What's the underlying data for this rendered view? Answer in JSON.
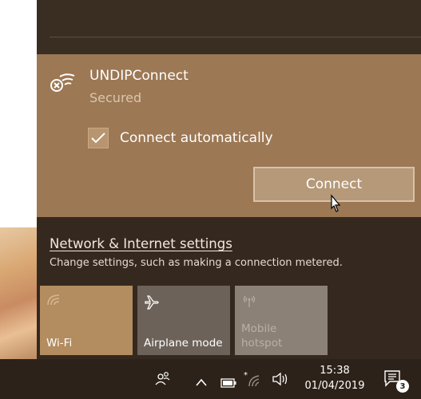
{
  "network": {
    "name": "UNDIPConnect",
    "status": "Secured",
    "connect_automatically_label": "Connect automatically",
    "connect_automatically_checked": true,
    "connect_button_label": "Connect"
  },
  "settings": {
    "link_label": "Network & Internet settings",
    "description": "Change settings, such as making a connection metered."
  },
  "quick_actions": [
    {
      "label": "Wi-Fi",
      "icon": "wifi-icon",
      "active": true
    },
    {
      "label": "Airplane mode",
      "icon": "airplane-icon",
      "active": false
    },
    {
      "label": "Mobile hotspot",
      "icon": "hotspot-icon",
      "active": false,
      "disabled": true
    }
  ],
  "taskbar": {
    "time": "15:38",
    "date": "01/04/2019",
    "notification_count": "3"
  },
  "colors": {
    "flyout_bg": "#35291f",
    "selected_network_bg": "#9c7854",
    "wifi_tile_active": "#b38c5f",
    "taskbar_bg": "#2d2219"
  }
}
